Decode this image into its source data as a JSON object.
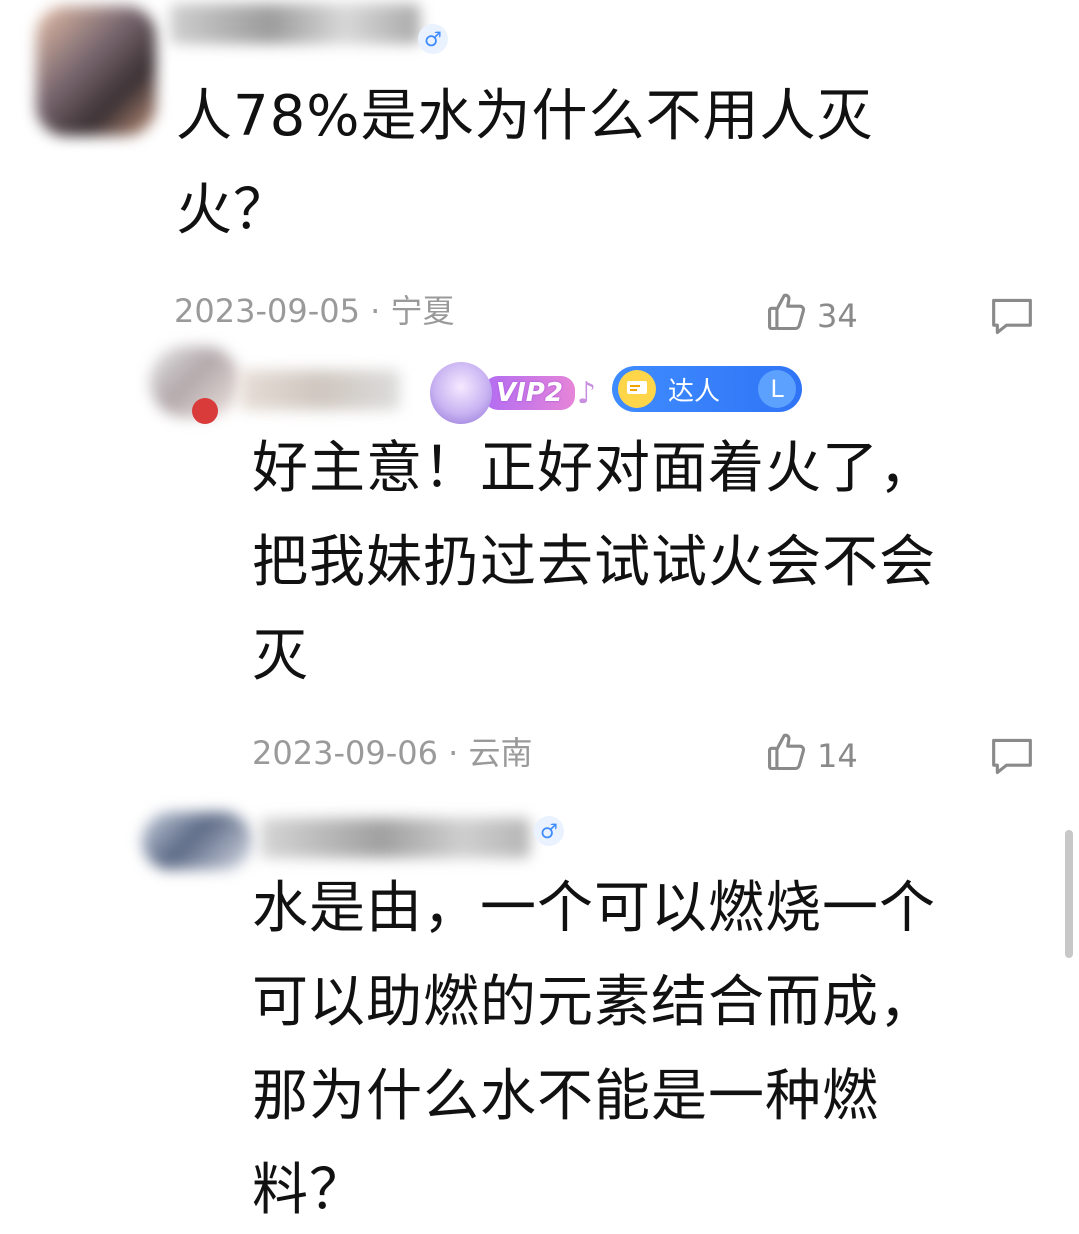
{
  "comments": [
    {
      "text": "人78%是水为什么不用人灭\n火？",
      "date": "2023-09-05",
      "separator": "·",
      "location": "宁夏",
      "likes": "34"
    },
    {
      "text": "好主意！正好对面着火了，\n把我妹扔过去试试火会不会\n灭",
      "date": "2023-09-06",
      "separator": "·",
      "location": "云南",
      "likes": "14",
      "vip_label": "VIP2",
      "talent_label": "达人",
      "talent_level": "L"
    },
    {
      "text": "水是由，一个可以燃烧一个\n可以助燃的元素结合而成，\n那为什么水不能是一种燃\n料？"
    }
  ],
  "icons": {
    "gender": "male-icon",
    "like": "thumbs-up-icon",
    "reply": "comment-bubble-icon"
  },
  "colors": {
    "text": "#111111",
    "meta": "#9a9a9a",
    "accent": "#3d8bff"
  }
}
